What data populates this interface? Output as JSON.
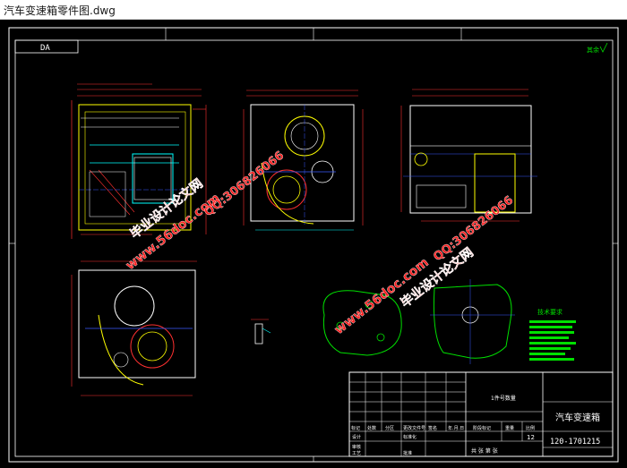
{
  "window": {
    "title": "汽车变速箱零件图.dwg"
  },
  "drawing": {
    "corner_label": "DA",
    "drawing_mark": "其余",
    "tech_req_title": "技术要求",
    "watermarks": {
      "site": "www.56doc.com",
      "name": "毕业设计论文网",
      "qq": "QQ:306826066"
    },
    "title_block": {
      "part_name": "汽车变速箱",
      "drawing_no": "120-1701215",
      "center_text": "1件号数量",
      "sheet_count": "12",
      "header_cells": [
        "标记",
        "处数",
        "分区",
        "更改文件号",
        "签名",
        "年.月.日"
      ],
      "role_design": "设计",
      "role_check": "审核",
      "role_process": "工艺",
      "role_std": "标准化",
      "role_approve": "批准",
      "stage_label": "阶段标记",
      "weight_label": "重量",
      "scale_label": "比例",
      "sheet_text": "共 张 第 张"
    }
  },
  "colors": {
    "frame": "#ffffff",
    "yellow": "#ffff00",
    "cyan": "#00ffff",
    "red": "#ff3030",
    "blue": "#3a5bff",
    "green": "#00e000",
    "magenta": "#ff40ff",
    "watermark": "#ff2020"
  }
}
